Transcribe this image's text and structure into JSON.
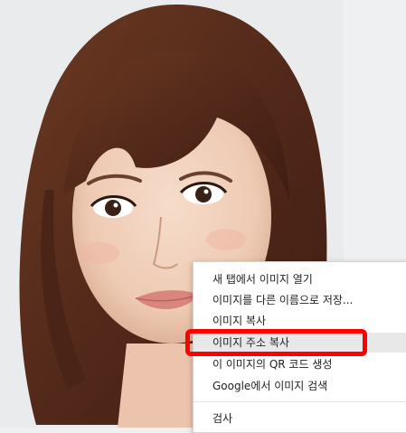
{
  "page": {
    "image_description_icon": "portrait-photo"
  },
  "context_menu": {
    "items": [
      {
        "label": "새 탭에서 이미지 열기"
      },
      {
        "label": "이미지를 다른 이름으로 저장..."
      },
      {
        "label": "이미지 복사"
      },
      {
        "label": "이미지 주소 복사"
      },
      {
        "label": "이 이미지의 QR 코드 생성"
      },
      {
        "label": "Google에서 이미지 검색"
      },
      {
        "label": "검사"
      }
    ],
    "hovered_index": 3
  },
  "colors": {
    "highlight": "#ff0000",
    "menu_bg": "#ffffff",
    "hover_bg": "#e8e8e8",
    "page_bg": "#eef0f1"
  }
}
